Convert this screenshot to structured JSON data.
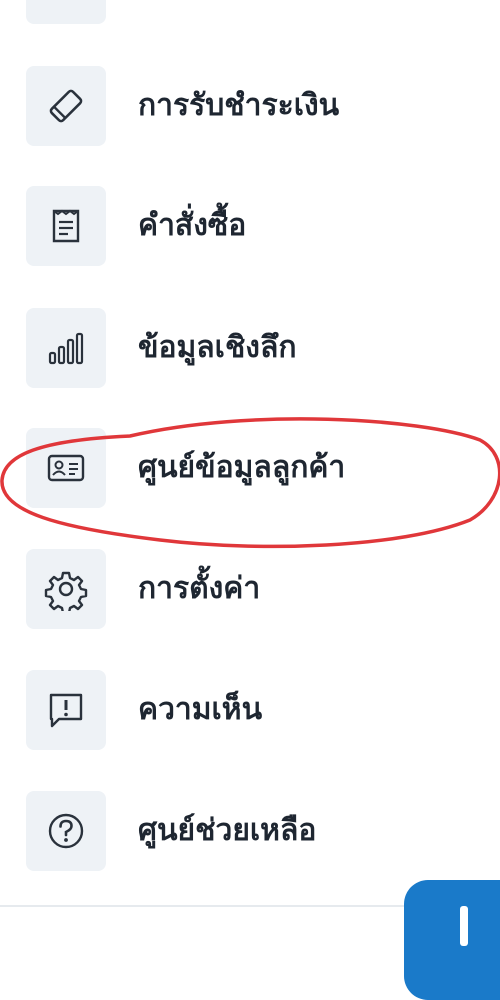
{
  "menu": {
    "items": [
      {
        "label": "การรับชำระเงิน",
        "icon": "card-tag-icon"
      },
      {
        "label": "คำสั่งซื้อ",
        "icon": "receipt-icon"
      },
      {
        "label": "ข้อมูลเชิงลึก",
        "icon": "bar-chart-icon"
      },
      {
        "label": "ศูนย์ข้อมูลลูกค้า",
        "icon": "contact-card-icon"
      },
      {
        "label": "การตั้งค่า",
        "icon": "gear-icon"
      },
      {
        "label": "ความเห็น",
        "icon": "feedback-icon"
      },
      {
        "label": "ศูนย์ช่วยเหลือ",
        "icon": "help-icon"
      }
    ]
  },
  "annotation": {
    "highlight_color": "#e0373a",
    "highlighted_item": "ศูนย์ข้อมูลลูกค้า"
  },
  "fab": {
    "icon": "plus-icon",
    "color": "#1a7ac9"
  }
}
